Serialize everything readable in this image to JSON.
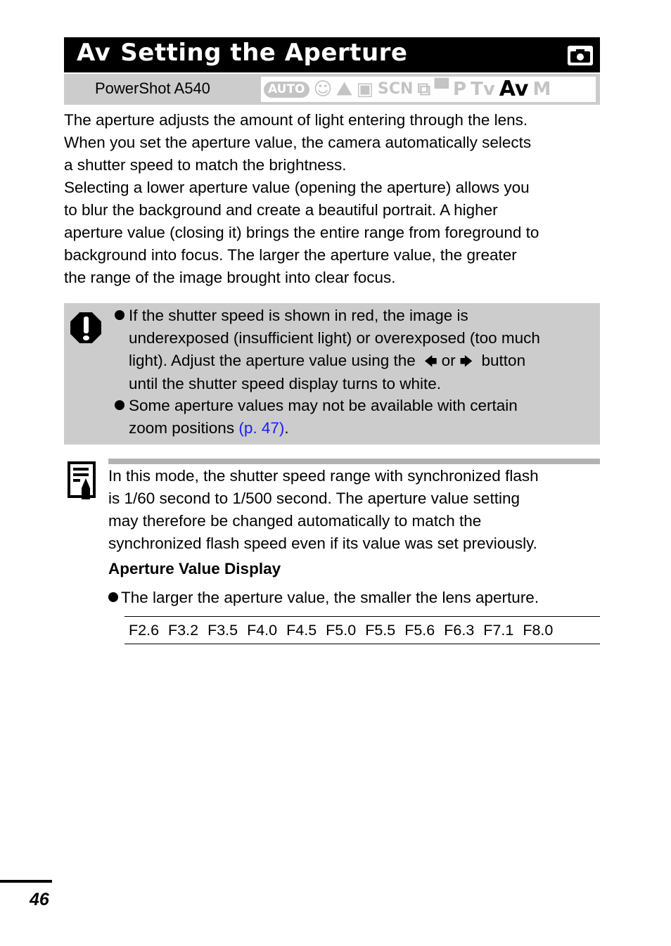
{
  "header": {
    "mode_label": "Av",
    "title": "Setting the Aperture",
    "icon": "camera-icon"
  },
  "mode_bar": {
    "model": "PowerShot A540",
    "modes": [
      {
        "label": "AUTO",
        "active": false
      },
      {
        "label": "portrait",
        "icon": "portrait-icon",
        "active": false
      },
      {
        "label": "landscape",
        "icon": "landscape-icon",
        "active": false
      },
      {
        "label": "night-scene",
        "icon": "night-scene-icon",
        "active": false
      },
      {
        "label": "SCN",
        "active": false
      },
      {
        "label": "stitch-assist",
        "icon": "stitch-assist-icon",
        "active": false
      },
      {
        "label": "movie",
        "icon": "movie-icon",
        "active": false
      },
      {
        "label": "P",
        "active": false
      },
      {
        "label": "Tv",
        "active": false
      },
      {
        "label": "Av",
        "active": true
      },
      {
        "label": "M",
        "active": false
      }
    ]
  },
  "intro": [
    "The aperture adjusts the amount of light entering through the lens.",
    "When you set the aperture value, the camera automatically selects",
    "a shutter speed to match the brightness.",
    "Selecting a lower aperture value (opening the aperture) allows you",
    "to blur the background and create a beautiful portrait. A higher",
    "aperture value (closing it) brings the entire range from foreground to",
    "background into focus. The larger the aperture value, the greater",
    "the range of the image brought into clear focus."
  ],
  "caution": {
    "icon": "caution-icon",
    "bullet1": {
      "line1": "If the shutter speed is shown in red, the image is",
      "line2": "underexposed (insufficient light) or overexposed (too much",
      "line3_pre": "light). Adjust the aperture value using the",
      "left_arrow": "🡄",
      "or": "or",
      "right_arrow": "🡆",
      "line3_post": "button",
      "line4": "until the shutter speed display turns to white."
    },
    "bullet2": {
      "line1": "Some aperture values may not be available with certain",
      "line2_pre": "zoom positions ",
      "link": "(p. 47)",
      "line2_post": "."
    }
  },
  "note": {
    "icon": "note-icon",
    "lines": [
      "In this mode, the shutter speed range with synchronized flash",
      "is 1/60 second to 1/500 second. The aperture value setting",
      "may therefore be changed automatically to match the",
      "synchronized flash speed even if its value was set previously."
    ],
    "subheading": "Aperture Value Display",
    "bullet": "The larger the aperture value, the smaller the lens aperture.",
    "f_values": [
      "F2.6",
      "F3.2",
      "F3.5",
      "F4.0",
      "F4.5",
      "F5.0",
      "F5.5",
      "F5.6",
      "F6.3",
      "F7.1",
      "F8.0"
    ]
  },
  "footer": {
    "page_number": "46"
  },
  "colors": {
    "link": "#1a1aff",
    "box_gray": "#cccccc",
    "mode_inactive": "#c4c4c4"
  }
}
